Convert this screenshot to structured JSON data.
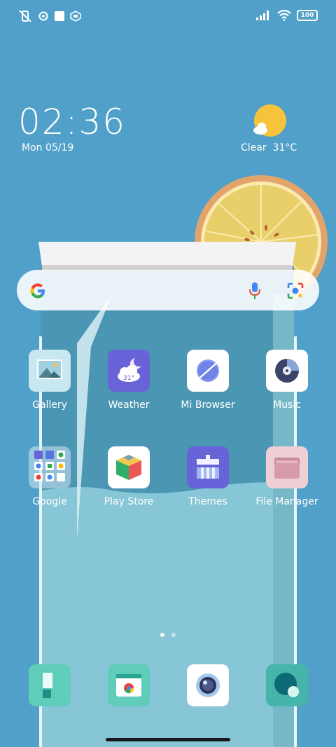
{
  "status_bar": {
    "icons_left": [
      "vibrate-off-icon",
      "settings-icon",
      "square-icon",
      "app-notification-icon"
    ],
    "icons_right": [
      "signal-icon",
      "wifi-icon",
      "battery-icon"
    ],
    "battery": "100"
  },
  "clock": {
    "time": "02:36",
    "date": "Mon 05/19"
  },
  "weather_widget": {
    "condition": "Clear",
    "temperature": "31°C",
    "icon": "sun-cloud-icon"
  },
  "search_bar": {
    "logo": "google-logo",
    "mic": "mic-icon",
    "lens": "lens-icon"
  },
  "apps_row1": [
    {
      "label": "Gallery",
      "icon": "gallery-icon"
    },
    {
      "label": "Weather",
      "icon": "weather-icon",
      "badge": "31°"
    },
    {
      "label": "Mi Browser",
      "icon": "browser-icon"
    },
    {
      "label": "Music",
      "icon": "music-icon"
    }
  ],
  "apps_row2": [
    {
      "label": "Google",
      "icon": "google-folder-icon"
    },
    {
      "label": "Play Store",
      "icon": "play-store-icon"
    },
    {
      "label": "Themes",
      "icon": "themes-icon"
    },
    {
      "label": "File Manager",
      "icon": "file-manager-icon"
    }
  ],
  "dock": [
    {
      "icon": "notes-icon"
    },
    {
      "icon": "chrome-icon"
    },
    {
      "icon": "camera-icon"
    },
    {
      "icon": "messages-icon"
    }
  ],
  "page_indicator": {
    "pages": 2,
    "current": 1
  },
  "colors": {
    "background": "#4f9fc9",
    "water": "#86c6d6",
    "orange": "#e8cf6a"
  }
}
